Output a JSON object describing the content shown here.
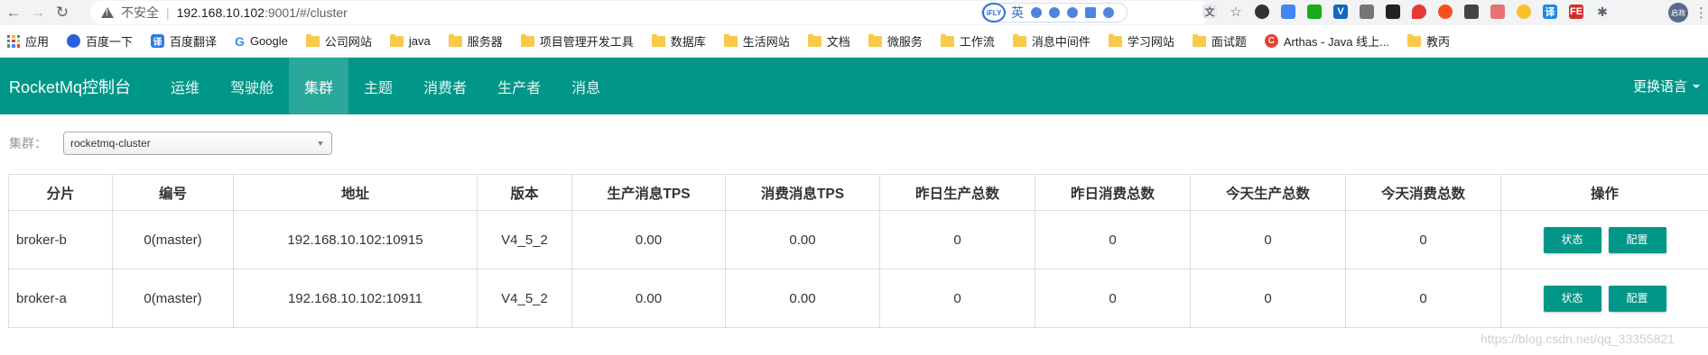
{
  "browser": {
    "insecure_label": "不安全",
    "url_host": "192.168.10.102",
    "url_rest": ":9001/#/cluster",
    "ifly_logo": "iFLY",
    "ifly_lang": "英",
    "profile_label": "启政"
  },
  "bookmarks": [
    {
      "label": "应用",
      "icon": "apps-icon"
    },
    {
      "label": "百度一下",
      "icon": "baidu-icon"
    },
    {
      "label": "百度翻译",
      "icon": "fanyi-icon"
    },
    {
      "label": "Google",
      "icon": "google-icon"
    },
    {
      "label": "公司网站",
      "icon": "folder-icon"
    },
    {
      "label": "java",
      "icon": "folder-icon"
    },
    {
      "label": "服务器",
      "icon": "folder-icon"
    },
    {
      "label": "项目管理开发工具",
      "icon": "folder-icon"
    },
    {
      "label": "数据库",
      "icon": "folder-icon"
    },
    {
      "label": "生活网站",
      "icon": "folder-icon"
    },
    {
      "label": "文档",
      "icon": "folder-icon"
    },
    {
      "label": "微服务",
      "icon": "folder-icon"
    },
    {
      "label": "工作流",
      "icon": "folder-icon"
    },
    {
      "label": "消息中间件",
      "icon": "folder-icon"
    },
    {
      "label": "学习网站",
      "icon": "folder-icon"
    },
    {
      "label": "面试题",
      "icon": "folder-icon"
    },
    {
      "label": "Arthas - Java 线上...",
      "icon": "csdn-icon"
    },
    {
      "label": "教丙",
      "icon": "folder-icon"
    }
  ],
  "navbar": {
    "brand": "RocketMq控制台",
    "items": [
      "运维",
      "驾驶舱",
      "集群",
      "主题",
      "消费者",
      "生产者",
      "消息"
    ],
    "active_index": 2,
    "language": "更换语言"
  },
  "filter": {
    "label": "集群：",
    "selected": "rocketmq-cluster"
  },
  "table": {
    "headers": [
      "分片",
      "编号",
      "地址",
      "版本",
      "生产消息TPS",
      "消费消息TPS",
      "昨日生产总数",
      "昨日消费总数",
      "今天生产总数",
      "今天消费总数",
      "操作"
    ],
    "rows": [
      {
        "shard": "broker-b",
        "id": "0(master)",
        "address": "192.168.10.102:10915",
        "version": "V4_5_2",
        "produce_tps": "0.00",
        "consume_tps": "0.00",
        "yesterday_produce": "0",
        "yesterday_consume": "0",
        "today_produce": "0",
        "today_consume": "0"
      },
      {
        "shard": "broker-a",
        "id": "0(master)",
        "address": "192.168.10.102:10911",
        "version": "V4_5_2",
        "produce_tps": "0.00",
        "consume_tps": "0.00",
        "yesterday_produce": "0",
        "yesterday_consume": "0",
        "today_produce": "0",
        "today_consume": "0"
      }
    ],
    "actions": {
      "status": "状态",
      "config": "配置"
    }
  },
  "watermark": "https://blog.csdn.net/qq_33355821",
  "colors": {
    "primary": "#009688",
    "nav_active": "#2aa89a"
  }
}
